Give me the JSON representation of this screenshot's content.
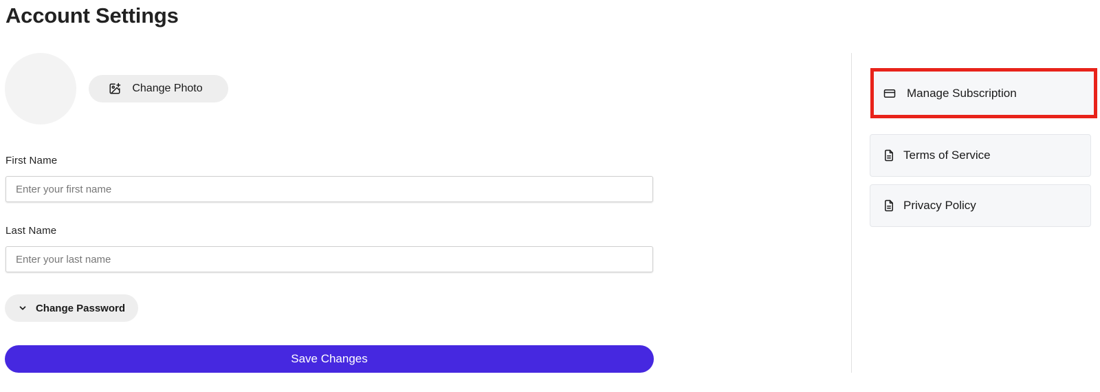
{
  "page": {
    "title": "Account Settings"
  },
  "profile": {
    "change_photo_label": "Change Photo",
    "change_photo_icon": "image-plus-icon"
  },
  "form": {
    "first_name": {
      "label": "First Name",
      "placeholder": "Enter your first name",
      "value": ""
    },
    "last_name": {
      "label": "Last Name",
      "placeholder": "Enter your last name",
      "value": ""
    },
    "change_password_label": "Change Password",
    "change_password_icon": "chevron-down-icon",
    "save_label": "Save Changes"
  },
  "sidebar": {
    "items": [
      {
        "label": "Manage Subscription",
        "icon": "credit-card-icon",
        "highlighted": true
      },
      {
        "label": "Terms of Service",
        "icon": "document-icon",
        "highlighted": false
      },
      {
        "label": "Privacy Policy",
        "icon": "document-icon",
        "highlighted": false
      }
    ]
  },
  "colors": {
    "primary": "#4628e0",
    "highlight_border": "#e8231a",
    "pill_background": "#eeeeee",
    "sidebar_item_background": "#f6f7f9"
  }
}
